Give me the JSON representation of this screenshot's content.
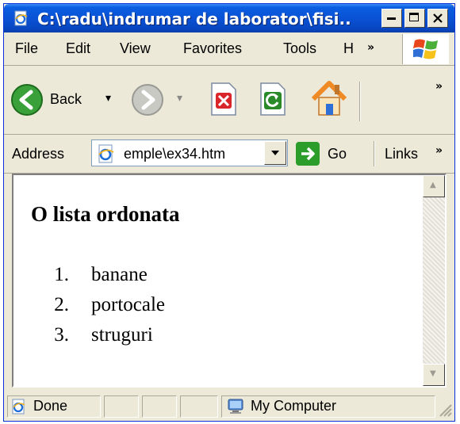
{
  "window": {
    "title": "C:\\radu\\indrumar de laborator\\fisi...",
    "minimize_glyph": "_",
    "maximize_glyph": "□",
    "close_glyph": "✕"
  },
  "menu": {
    "items": [
      "File",
      "Edit",
      "View",
      "Favorites",
      "Tools",
      "H"
    ],
    "overflow": "»"
  },
  "toolbar": {
    "back_label": "Back",
    "back_dropdown": "▾",
    "forward_dropdown": "▾",
    "overflow": "»"
  },
  "address": {
    "label": "Address",
    "value": "emple\\ex34.htm",
    "go_label": "Go",
    "links_label": "Links",
    "overflow": "»"
  },
  "page": {
    "heading": "O lista ordonata",
    "list": [
      {
        "number": "1.",
        "text": "banane"
      },
      {
        "number": "2.",
        "text": "portocale"
      },
      {
        "number": "3.",
        "text": "struguri"
      }
    ]
  },
  "scroll": {
    "up": "▲",
    "down": "▼"
  },
  "status": {
    "left_text": "Done",
    "zone_text": "My Computer"
  },
  "icons": {
    "ie_page": "ie-page-icon",
    "back": "back-arrow-icon",
    "forward": "forward-arrow-icon",
    "stop": "stop-icon",
    "refresh": "refresh-icon",
    "home": "home-icon",
    "go": "go-arrow-icon",
    "windows_logo": "windows-logo-icon",
    "computer": "computer-icon",
    "resize_grip": "resize-grip-icon"
  },
  "colors": {
    "title_bar": "#0a52d6",
    "chrome": "#ece9d8",
    "back_green": "#3aa13a",
    "stop_red": "#d8262a",
    "refresh_green": "#2a8a2a",
    "home_orange": "#f08a24"
  }
}
